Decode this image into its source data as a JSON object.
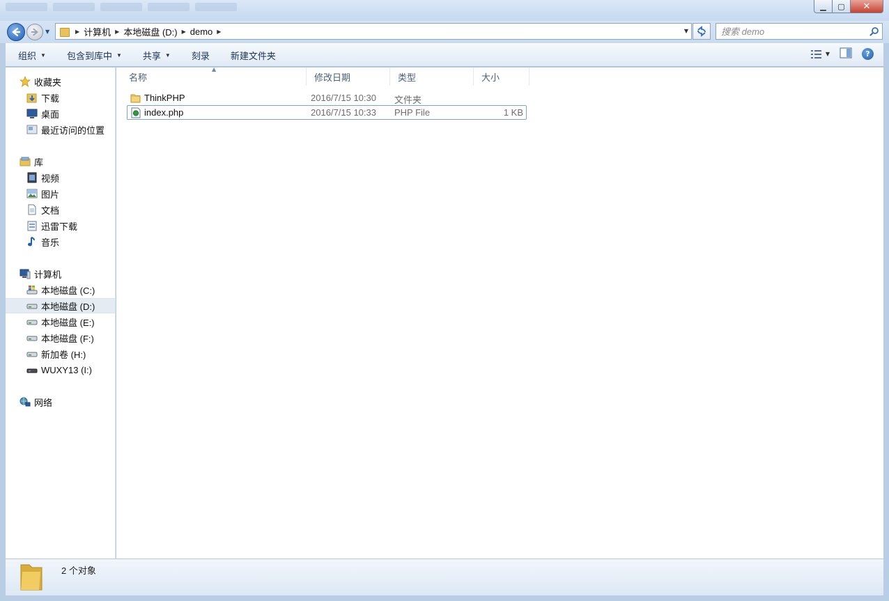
{
  "window": {
    "minimize_glyph": "▁",
    "maximize_glyph": "▢",
    "close_glyph": "✕"
  },
  "nav": {
    "breadcrumbs": [
      "计算机",
      "本地磁盘 (D:)",
      "demo"
    ],
    "search_placeholder": "搜索 demo"
  },
  "toolbar": {
    "organize": "组织",
    "include_in_library": "包含到库中",
    "share": "共享",
    "burn": "刻录",
    "new_folder": "新建文件夹"
  },
  "sidebar": {
    "favorites": {
      "label": "收藏夹",
      "items": [
        "下载",
        "桌面",
        "最近访问的位置"
      ]
    },
    "libraries": {
      "label": "库",
      "items": [
        "视频",
        "图片",
        "文档",
        "迅雷下载",
        "音乐"
      ]
    },
    "computer": {
      "label": "计算机",
      "items": [
        "本地磁盘 (C:)",
        "本地磁盘 (D:)",
        "本地磁盘 (E:)",
        "本地磁盘 (F:)",
        "新加卷 (H:)",
        "WUXY13 (I:)"
      ],
      "selected": "本地磁盘 (D:)"
    },
    "network": {
      "label": "网络"
    }
  },
  "filelist": {
    "columns": {
      "name": "名称",
      "modified": "修改日期",
      "type": "类型",
      "size": "大小"
    },
    "files": [
      {
        "name": "ThinkPHP",
        "modified": "2016/7/15 10:30",
        "type": "文件夹",
        "size": "",
        "icon": "folder-icon"
      },
      {
        "name": "index.php",
        "modified": "2016/7/15 10:33",
        "type": "PHP File",
        "size": "1 KB",
        "icon": "php-file-icon"
      }
    ]
  },
  "details": {
    "count_text": "2 个对象"
  },
  "colors": {
    "accent": "#1f5fb6",
    "selection_border": "#7da2ce",
    "chrome": "#c6d9f0"
  }
}
